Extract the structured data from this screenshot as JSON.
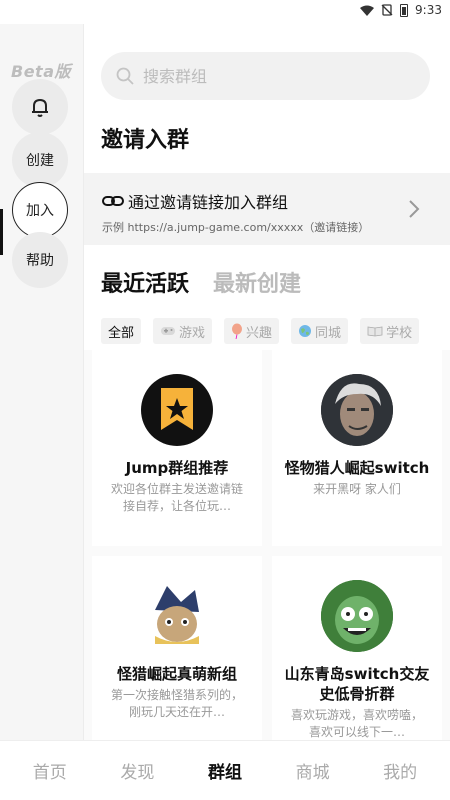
{
  "status_bar": {
    "time": "9:33",
    "icons": [
      "wifi-icon",
      "no-sim-icon",
      "battery-icon"
    ]
  },
  "rail": {
    "badge": "Beta版",
    "items": [
      {
        "label": "",
        "icon": "bell-icon"
      },
      {
        "label": "创建"
      },
      {
        "label": "加入",
        "active": true
      },
      {
        "label": "帮助"
      }
    ]
  },
  "search": {
    "placeholder": "搜索群组",
    "value": ""
  },
  "invite": {
    "title": "邀请入群",
    "link_label": "通过邀请链接加入群组",
    "example": "示例 https://a.jump-game.com/xxxxx（邀请链接）"
  },
  "tabs": [
    {
      "label": "最近活跃",
      "active": true
    },
    {
      "label": "最新创建",
      "active": false
    }
  ],
  "filters": [
    {
      "label": "全部",
      "icon": "",
      "active": true
    },
    {
      "label": "游戏",
      "icon": "gamepad-icon"
    },
    {
      "label": "兴趣",
      "icon": "balloon-icon"
    },
    {
      "label": "同城",
      "icon": "globe-icon"
    },
    {
      "label": "学校",
      "icon": "book-icon"
    }
  ],
  "groups": [
    {
      "name": "Jump群组推荐",
      "desc": "欢迎各位群主发送邀请链接自荐，让各位玩…",
      "avatar": "star-bookmark-logo"
    },
    {
      "name": "怪物猎人崛起switch",
      "desc": "来开黑呀 家人们",
      "avatar": "hunter-portrait"
    },
    {
      "name": "怪猎崛起真萌新组",
      "desc": "第一次接触怪猎系列的，刚玩几天还在开…",
      "avatar": "palico-avatar"
    },
    {
      "name": "山东青岛switch交友史低骨折群",
      "desc": "喜欢玩游戏，喜欢唠嗑，喜欢可以线下一…",
      "avatar": "cartoon-face"
    }
  ],
  "bottom_nav": [
    {
      "label": "首页"
    },
    {
      "label": "发现"
    },
    {
      "label": "群组",
      "active": true
    },
    {
      "label": "商城"
    },
    {
      "label": "我的"
    }
  ],
  "colors": {
    "accent": "#111111",
    "muted": "#bbbbbb",
    "rail_bg": "#f6f6f6",
    "chip_bg": "#f2f2f2"
  }
}
